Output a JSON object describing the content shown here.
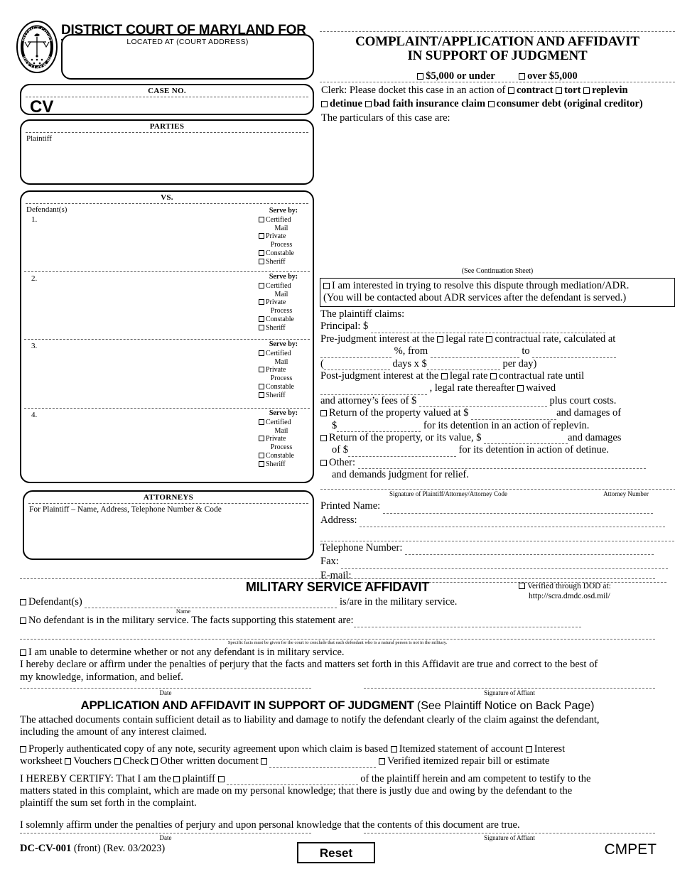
{
  "header": {
    "court_title": "DISTRICT COURT OF MARYLAND FOR",
    "located_at": "LOCATED AT (COURT ADDRESS)",
    "case_no_label": "CASE NO.",
    "case_prefix": "CV",
    "seal_text_top": "DISTRICT COURT",
    "seal_text_bottom": "OF MARYLAND"
  },
  "title_block": {
    "line1": "COMPLAINT/APPLICATION AND AFFIDAVIT",
    "line2": "IN SUPPORT OF JUDGMENT",
    "amount_under": "$5,000 or under",
    "amount_over": "over $5,000",
    "clerk_intro": "Clerk: Please docket this case in an action of",
    "action_contract": "contract",
    "action_tort": "tort",
    "action_replevin": "replevin",
    "action_detinue": "detinue",
    "action_bad_faith": "bad faith insurance claim",
    "action_consumer_debt": "consumer debt (original creditor)",
    "particulars": "The particulars of this case are:",
    "continuation": "(See Continuation Sheet)"
  },
  "parties": {
    "header": "PARTIES",
    "plaintiff_label": "Plaintiff",
    "vs_label": "VS.",
    "defendants_label": "Defendant(s)",
    "defendant_numbers": [
      "1.",
      "2.",
      "3.",
      "4."
    ],
    "serve_by": {
      "header": "Serve by:",
      "certified": "Certified",
      "certified_cont": "Mail",
      "private": "Private",
      "private_cont": "Process",
      "constable": "Constable",
      "sheriff": "Sheriff"
    }
  },
  "attorneys": {
    "header": "ATTORNEYS",
    "for_plaintiff": "For Plaintiff – Name, Address, Telephone Number & Code"
  },
  "adr": {
    "line1": "I am interested in trying to resolve this dispute through mediation/ADR.",
    "line2": "(You will be contacted about ADR services after the defendant is served.)"
  },
  "claims": {
    "intro": "The plaintiff claims:",
    "principal": "Principal: $",
    "prejudgment_1": "Pre-judgment interest at the",
    "legal_rate": "legal rate",
    "contractual_rate": "contractual rate, calculated at",
    "percent_from": "%, from",
    "to": "to",
    "days_x": "days x $",
    "per_day": "per day)",
    "postjudgment_1": "Post-judgment interest at the",
    "postjudgment_legal": "legal rate",
    "postjudgment_contractual": "contractual rate until",
    "legal_rate_thereafter": ", legal rate thereafter",
    "waived": "waived",
    "attorney_fees": "and attorney’s fees of $",
    "plus_court_costs": "plus court costs.",
    "replevin_1": "Return of the property valued at $",
    "replevin_2": "and damages of",
    "replevin_3": "$",
    "replevin_4": "for its detention in an action of replevin.",
    "detinue_1": "Return of the property, or its value, $",
    "detinue_2": "and damages",
    "detinue_3": "of $",
    "detinue_4": "for its detention in action of detinue.",
    "other": "Other:",
    "demands": "and demands judgment for relief."
  },
  "signature_block": {
    "sig_caption": "Signature of Plaintiff/Attorney/Attorney Code",
    "attorney_number": "Attorney Number",
    "printed_name": "Printed Name:",
    "address": "Address:",
    "telephone": "Telephone Number:",
    "fax": "Fax:",
    "email": "E-mail:"
  },
  "military": {
    "heading": "MILITARY SERVICE AFFIDAVIT",
    "dod_label": "Verified through DOD at:",
    "dod_url": "http://scra.dmdc.osd.mil/",
    "defendants_opt": "Defendant(s)",
    "name_caption": "Name",
    "is_are": "is/are in the military service.",
    "no_defendant": "No defendant is in the military service. The facts supporting this statement are:",
    "specific_facts": "Specific facts must be given for the court to conclude that each defendant who is a natural person is not in the military.",
    "unable": "I am unable to determine whether or not any defendant is in military service.",
    "declare_1": "I hereby declare or affirm under the penalties of perjury that the facts and matters set forth in this Affidavit are true and correct to the best of",
    "declare_2": "my knowledge, information, and belief.",
    "date_caption": "Date",
    "affiant_caption": "Signature of Affiant"
  },
  "application": {
    "heading_bold": "APPLICATION AND AFFIDAVIT IN SUPPORT OF JUDGMENT",
    "heading_reg": "(See Plaintiff Notice on Back Page)",
    "attached_1": "The attached documents contain sufficient detail as to liability and damage to notify the defendant clearly of the claim against the defendant,",
    "attached_2": "including the amount of any interest claimed.",
    "opt_note": "Properly authenticated copy of any note, security agreement upon which claim is based",
    "opt_itemized": "Itemized statement of account",
    "opt_interest": "Interest",
    "opt_worksheet": "worksheet",
    "opt_vouchers": "Vouchers",
    "opt_check": "Check",
    "opt_other_written": "Other written document",
    "opt_repair": "Verified itemized repair bill or estimate",
    "certify_1": "I HEREBY CERTIFY: That I am the",
    "certify_plaintiff": "plaintiff",
    "certify_2": "of the plaintiff herein and am competent to testify to the",
    "certify_3": "matters stated in this complaint, which are made on my personal knowledge; that there is justly due and owing by the defendant to the",
    "certify_4": "plaintiff the sum set forth in the complaint.",
    "solemnly": "I solemnly affirm under the penalties of perjury and upon personal knowledge that the contents of this document are true.",
    "date_caption": "Date",
    "affiant_caption": "Signature of Affiant"
  },
  "footer": {
    "form_id_bold": "DC-CV-001",
    "form_id_rest": "(front) (Rev. 03/2023)",
    "reset_label": "Reset",
    "code": "CMPET"
  }
}
